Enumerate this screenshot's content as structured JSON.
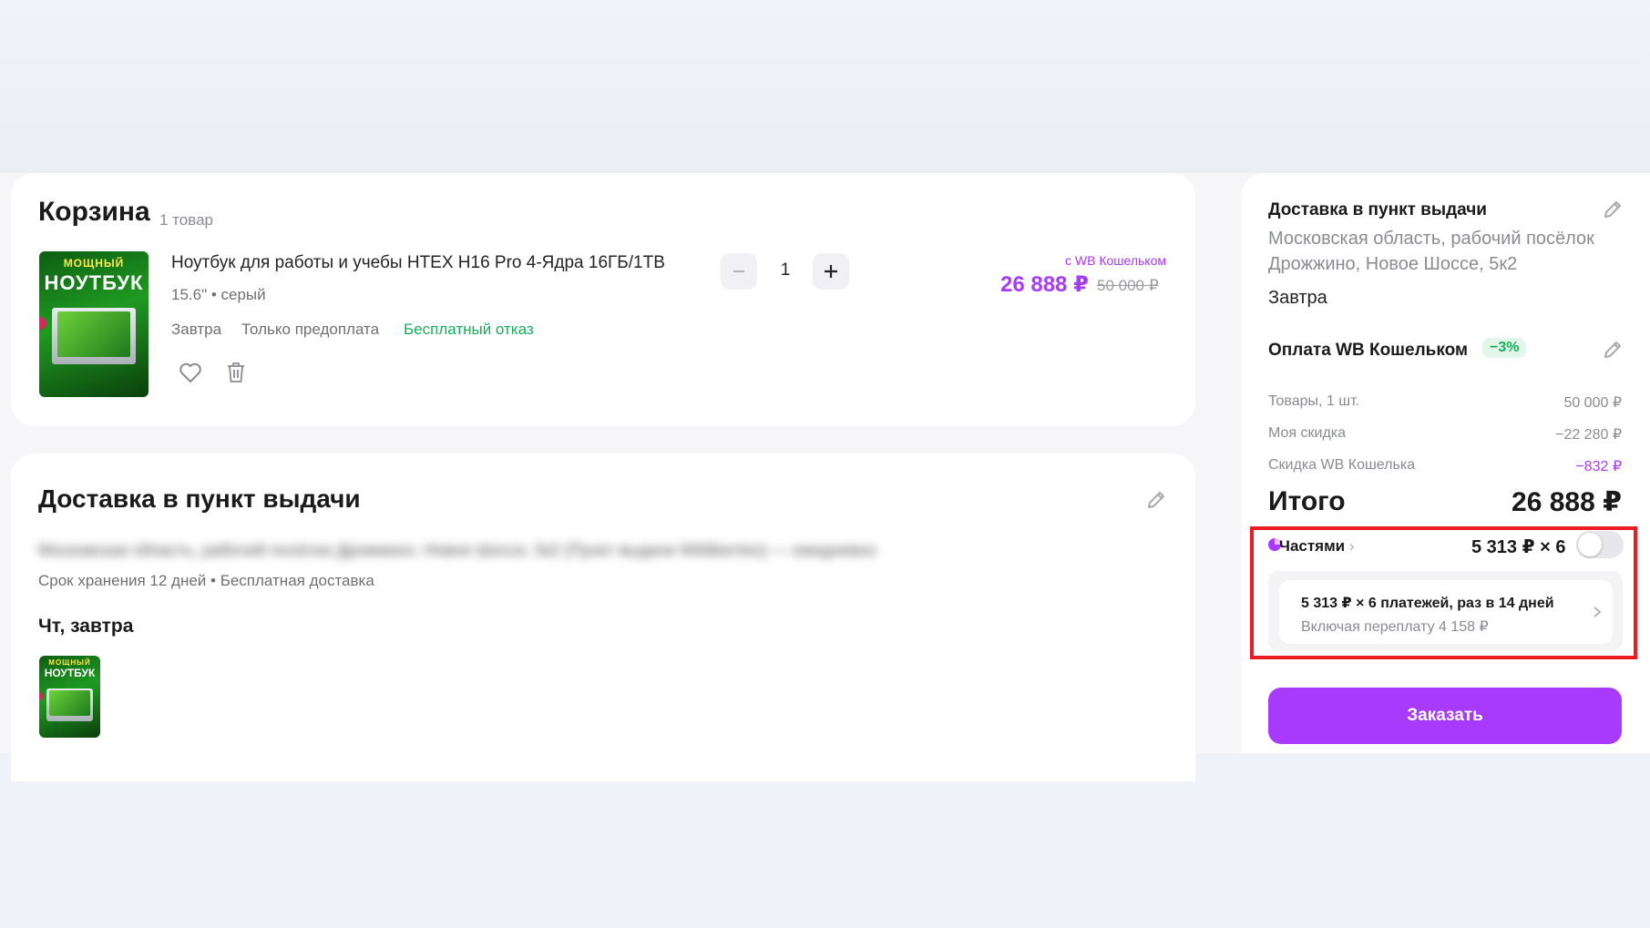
{
  "cart": {
    "title": "Корзина",
    "count": "1 товар",
    "item": {
      "name": "Ноутбук для работы и учебы HTEX H16 Pro 4-Ядра 16ГБ/1TB",
      "variant": "15.6\" • серый",
      "delivery": "Завтра",
      "prepay": "Только предоплата",
      "free_cancel": "Бесплатный отказ",
      "quantity": "1",
      "wallet_note": "с WB Кошельком",
      "price": "26 888 ₽",
      "old_price": "50 000 ₽",
      "thumb_text": "НОУТБУК",
      "thumb_text_top": "МОЩНЫЙ"
    }
  },
  "delivery_section": {
    "title": "Доставка в пункт выдачи",
    "address_blurred": "Московская область, рабочий посёлок Дрожжино, Новое Шоссе, 5к2 (Пункт выдачи Wildberries) — ежедневно",
    "storage": "Срок хранения 12 дней • Бесплатная доставка",
    "day": "Чт, завтра"
  },
  "summary": {
    "delivery_title": "Доставка в пункт выдачи",
    "address": "Московская область, рабочий посёлок Дрожжино, Новое Шоссе, 5к2",
    "when": "Завтра",
    "payment_title": "Оплата WB Кошельком",
    "payment_discount": "−3%",
    "rows": [
      {
        "label": "Товары, 1 шт.",
        "value": "50 000 ₽"
      },
      {
        "label": "Моя скидка",
        "value": "−22 280 ₽"
      },
      {
        "label": "Скидка WB Кошелька",
        "value": "−832 ₽"
      }
    ],
    "total_label": "Итого",
    "total_value": "26 888 ₽",
    "installments": {
      "label": "Частями",
      "amount": "5 313 ₽ × 6",
      "line1": "5 313 ₽ × 6 платежей, раз в 14 дней",
      "line2": "Включая переплату 4 158 ₽"
    },
    "order_button": "Заказать"
  },
  "colors": {
    "accent": "#a73afd",
    "green": "#13b05a",
    "highlight": "#ec1c24"
  }
}
